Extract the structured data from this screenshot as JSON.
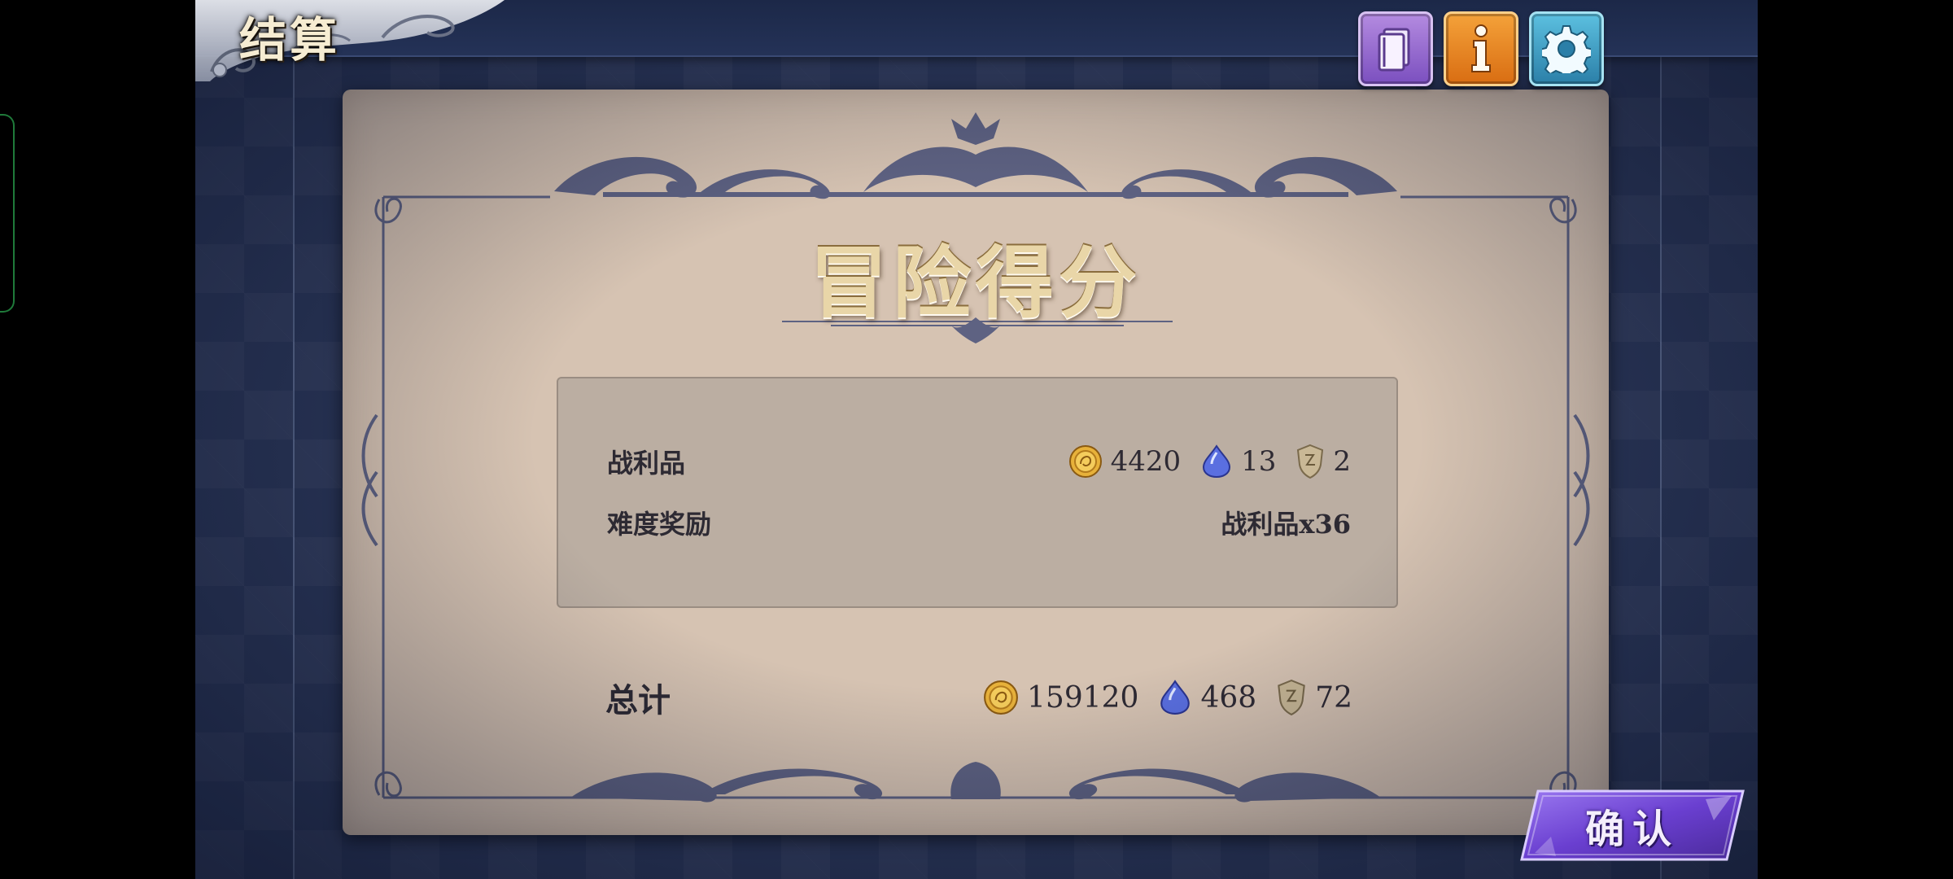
{
  "header": {
    "title": "结算",
    "buttons": [
      {
        "name": "codex",
        "icon": "book-icon"
      },
      {
        "name": "info",
        "icon": "info-icon"
      },
      {
        "name": "settings",
        "icon": "gear-icon"
      }
    ]
  },
  "panel": {
    "title": "冒险得分",
    "spoils": {
      "label": "战利品",
      "gold": "4420",
      "gem": "13",
      "crest": "2"
    },
    "difficulty_bonus": {
      "label": "难度奖励",
      "value": "战利品x36"
    },
    "total": {
      "label": "总计",
      "gold": "159120",
      "gem": "468",
      "crest": "72"
    }
  },
  "confirm_button": {
    "label": "确认"
  },
  "colors": {
    "panel_bg": "#d6c3b2",
    "ornament": "#5e6282",
    "background": "#2a3658",
    "confirm": "#7a4fd6"
  }
}
